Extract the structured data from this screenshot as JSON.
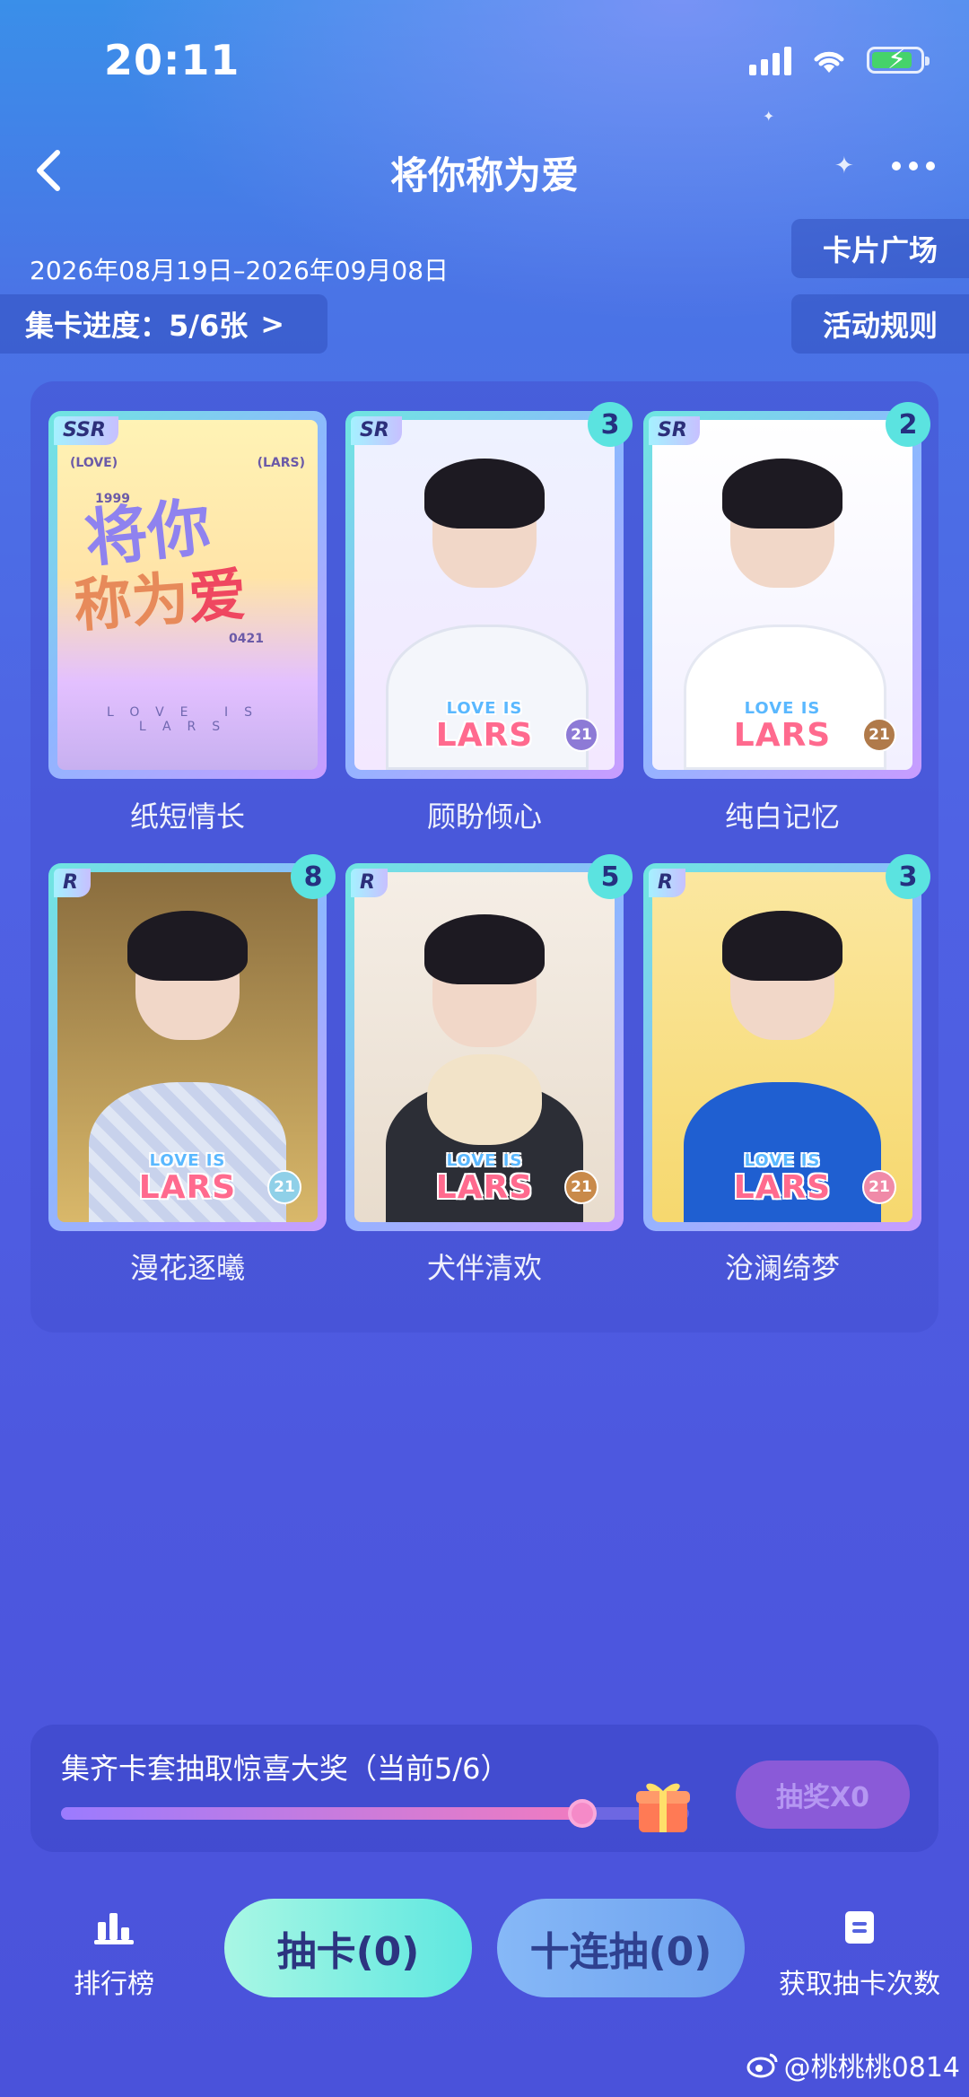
{
  "status_bar": {
    "time": "20:11"
  },
  "header": {
    "title": "将你称为爱"
  },
  "event": {
    "date_range": "2026年08月19日–2026年09月08日",
    "progress_label": "集卡进度：5/6张",
    "chevron": ">"
  },
  "side_buttons": {
    "card_plaza": "卡片广场",
    "rules": "活动规则"
  },
  "cards": [
    {
      "rarity": "SSR",
      "count": "",
      "name": "纸短情长",
      "owned": true
    },
    {
      "rarity": "SR",
      "count": "3",
      "name": "顾盼倾心",
      "owned": true
    },
    {
      "rarity": "SR",
      "count": "2",
      "name": "纯白记忆",
      "owned": true
    },
    {
      "rarity": "R",
      "count": "8",
      "name": "漫花逐曦",
      "owned": true
    },
    {
      "rarity": "R",
      "count": "5",
      "name": "犬伴清欢",
      "owned": true
    },
    {
      "rarity": "R",
      "count": "3",
      "name": "沧澜绮梦",
      "owned": true
    }
  ],
  "card_art": {
    "logo_top": "LOVE IS",
    "logo_main": "LARS",
    "badge": "21",
    "ssr_title_line1": "将你",
    "ssr_title_line2a": "称为",
    "ssr_title_line2b": "爱",
    "ssr_year": "1999",
    "ssr_date": "0421",
    "ssr_left_tag": "(LOVE)",
    "ssr_right_tag": "(LARS)",
    "ssr_footer": "LOVE IS LARS"
  },
  "reward": {
    "title": "集齐卡套抽取惊喜大奖（当前5/6）",
    "progress": 0.83,
    "lottery_label": "抽奖X0"
  },
  "bottom_nav": {
    "leaderboard": "排行榜",
    "draw_one": "抽卡(0)",
    "draw_ten": "十连抽(0)",
    "get_draws": "获取抽卡次数"
  },
  "watermark": "@桃桃桃0814",
  "colors": {
    "accent_cyan": "#5be3e0",
    "draw_btn": "#7ef0d8",
    "lottery_btn": "#8a5ad8",
    "progress_fill": "#f07bc0"
  }
}
